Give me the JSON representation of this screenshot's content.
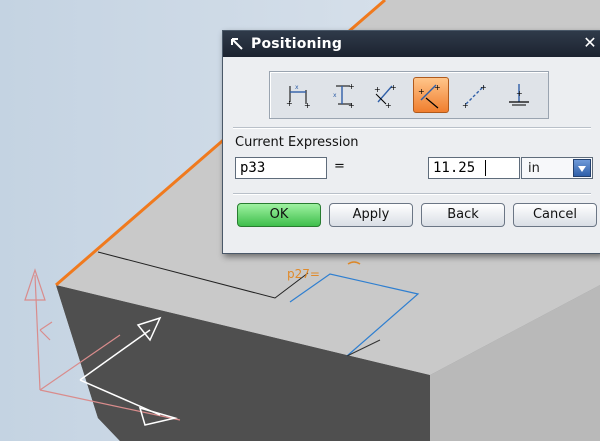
{
  "canvas": {
    "dimension_label": "p27="
  },
  "dialog": {
    "title": "Positioning",
    "close_glyph": "✕",
    "toolbar": {
      "tools": [
        {
          "icon": "horizontal-dimension-icon"
        },
        {
          "icon": "vertical-dimension-icon"
        },
        {
          "icon": "parallel-dimension-icon"
        },
        {
          "icon": "perpendicular-dimension-icon",
          "active": true
        },
        {
          "icon": "parallel-at-distance-icon"
        },
        {
          "icon": "angular-dimension-icon"
        }
      ]
    },
    "current_expression_label": "Current Expression",
    "expression_name": "p33",
    "equals": "=",
    "expression_value": "11.25",
    "unit": "in",
    "buttons": {
      "ok": "OK",
      "apply": "Apply",
      "back": "Back",
      "cancel": "Cancel"
    }
  },
  "colors": {
    "highlight_edge": "#f07a1e",
    "dimension_blue": "#2f7fd0",
    "csys_pink": "#d98c8c"
  }
}
